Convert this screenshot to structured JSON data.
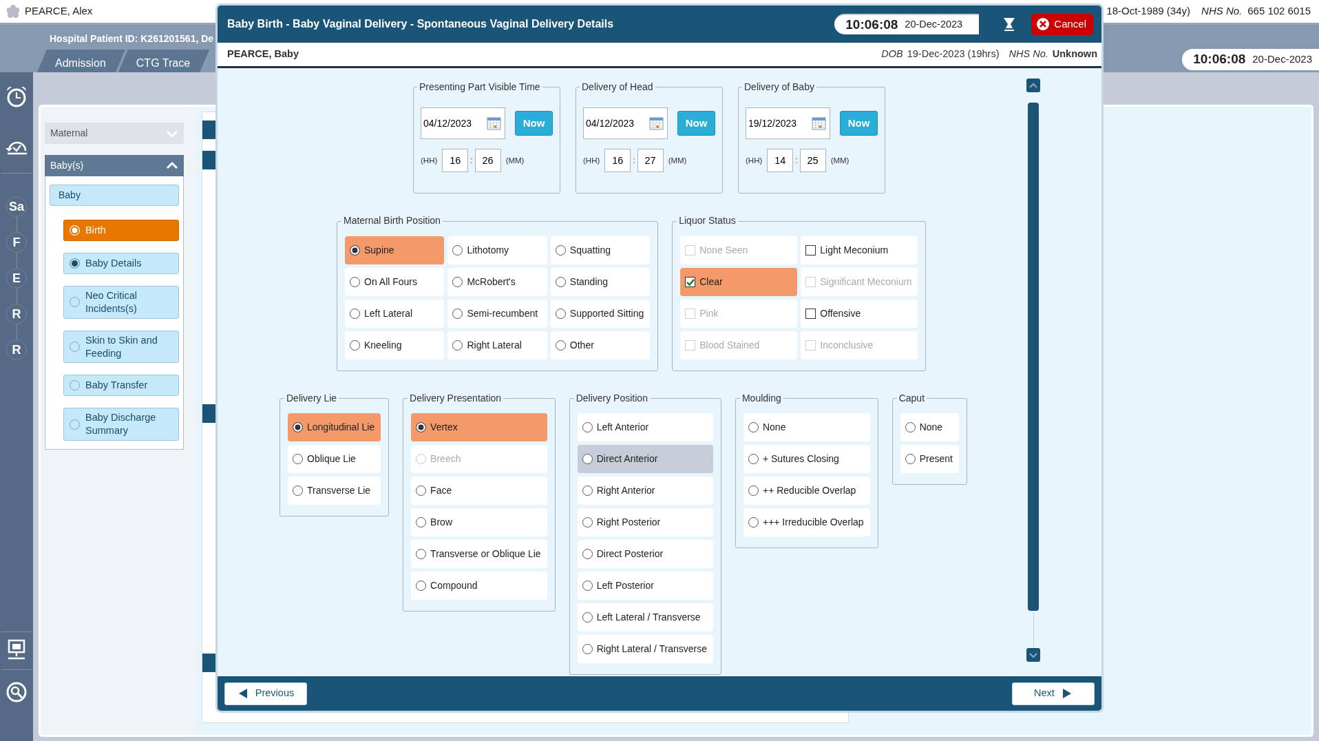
{
  "app": {
    "patient_name": "PEARCE, Alex",
    "patient_id": "Hospital Patient ID: K261201561, De",
    "dob": "18-Oct-1989 (34y)",
    "nhs_label": "NHS No.",
    "nhs_number": "665 102 6015",
    "time": "10:06:08",
    "date": "20-Dec-2023",
    "tabs": [
      {
        "label": "Admission",
        "selected": false
      },
      {
        "label": "CTG Trace",
        "selected": false
      }
    ],
    "steps": [
      "Sa",
      "F",
      "E",
      "R",
      "R"
    ]
  },
  "sidebar": {
    "groups": [
      {
        "label": "Maternal",
        "expanded": false
      },
      {
        "label": "Baby(s)",
        "expanded": true
      }
    ],
    "parent": "Baby",
    "items": [
      {
        "label": "Birth",
        "selected": true,
        "complete": false
      },
      {
        "label": "Baby Details",
        "selected": false,
        "complete": true
      },
      {
        "label": "Neo Critical Incidents(s)",
        "selected": false,
        "complete": false
      },
      {
        "label": "Skin to Skin and Feeding",
        "selected": false,
        "complete": false
      },
      {
        "label": "Baby Transfer",
        "selected": false,
        "complete": false
      },
      {
        "label": "Baby Discharge Summary",
        "selected": false,
        "complete": false
      }
    ]
  },
  "modal": {
    "title": "Baby Birth - Baby Vaginal Delivery - Spontaneous Vaginal Delivery Details",
    "time": "10:06:08",
    "date": "20-Dec-2023",
    "cancel": "Cancel",
    "patient": "PEARCE, Baby",
    "dob_label": "DOB",
    "dob": "19-Dec-2023 (19hrs)",
    "nhs_label": "NHS No.",
    "nhs": "Unknown",
    "previous": "Previous",
    "next": "Next",
    "rows": [
      {
        "groups": [
          {
            "kind": "time",
            "legend": "Presenting Part Visible Time",
            "date": "04/12/2023",
            "now": "Now",
            "hh_label": "(HH)",
            "hh": "16",
            "separator": ":",
            "mm": "26",
            "mm_label": "(MM)"
          },
          {
            "kind": "time",
            "legend": "Delivery of Head",
            "date": "04/12/2023",
            "now": "Now",
            "hh_label": "(HH)",
            "hh": "16",
            "separator": ":",
            "mm": "27",
            "mm_label": "(MM)"
          },
          {
            "kind": "time",
            "legend": "Delivery of Baby",
            "date": "19/12/2023",
            "now": "Now",
            "hh_label": "(HH)",
            "hh": "14",
            "separator": ":",
            "mm": "25",
            "mm_label": "(MM)"
          }
        ]
      },
      {
        "groups": [
          {
            "kind": "radio",
            "legend": "Maternal Birth Position",
            "option_rows": [
              [
                {
                  "label": "Supine",
                  "selected": true
                },
                {
                  "label": "Lithotomy",
                  "selected": false
                },
                {
                  "label": "Squatting",
                  "selected": false
                }
              ],
              [
                {
                  "label": "On All Fours",
                  "selected": false
                },
                {
                  "label": "McRobert's",
                  "selected": false
                },
                {
                  "label": "Standing",
                  "selected": false
                }
              ],
              [
                {
                  "label": "Left Lateral",
                  "selected": false
                },
                {
                  "label": "Semi-recumbent",
                  "selected": false
                },
                {
                  "label": "Supported Sitting",
                  "selected": false
                }
              ],
              [
                {
                  "label": "Kneeling",
                  "selected": false
                },
                {
                  "label": "Right Lateral",
                  "selected": false
                },
                {
                  "label": "Other",
                  "selected": false
                }
              ]
            ]
          },
          {
            "kind": "checkbox",
            "legend": "Liquor Status",
            "option_rows": [
              [
                {
                  "label": "None Seen",
                  "checked": false,
                  "disabled": true
                },
                {
                  "label": "Light Meconium",
                  "checked": false,
                  "disabled": false
                }
              ],
              [
                {
                  "label": "Clear",
                  "checked": true,
                  "disabled": false
                },
                {
                  "label": "Significant Meconium",
                  "checked": false,
                  "disabled": true
                }
              ],
              [
                {
                  "label": "Pink",
                  "checked": false,
                  "disabled": true
                },
                {
                  "label": "Offensive",
                  "checked": false,
                  "disabled": false
                }
              ],
              [
                {
                  "label": "Blood Stained",
                  "checked": false,
                  "disabled": true
                },
                {
                  "label": "Inconclusive",
                  "checked": false,
                  "disabled": true
                }
              ]
            ]
          }
        ]
      },
      {
        "groups": [
          {
            "kind": "radio",
            "legend": "Delivery Lie",
            "option_rows": [
              [
                {
                  "label": "Longitudinal Lie",
                  "selected": true
                }
              ],
              [
                {
                  "label": "Oblique Lie",
                  "selected": false
                }
              ],
              [
                {
                  "label": "Transverse Lie",
                  "selected": false
                }
              ]
            ]
          },
          {
            "kind": "radio",
            "legend": "Delivery Presentation",
            "option_rows": [
              [
                {
                  "label": "Vertex",
                  "selected": true,
                  "disabled": false
                }
              ],
              [
                {
                  "label": "Breech",
                  "selected": false,
                  "disabled": true
                }
              ],
              [
                {
                  "label": "Face",
                  "selected": false,
                  "disabled": false
                }
              ],
              [
                {
                  "label": "Brow",
                  "selected": false,
                  "disabled": false
                }
              ],
              [
                {
                  "label": "Transverse or Oblique Lie",
                  "selected": false,
                  "disabled": false
                }
              ],
              [
                {
                  "label": "Compound",
                  "selected": false,
                  "disabled": false
                }
              ]
            ]
          },
          {
            "kind": "radio",
            "legend": "Delivery Position",
            "option_rows": [
              [
                {
                  "label": "Left Anterior",
                  "selected": false,
                  "highlighted": false
                }
              ],
              [
                {
                  "label": "Direct Anterior",
                  "selected": false,
                  "highlighted": true
                }
              ],
              [
                {
                  "label": "Right Anterior",
                  "selected": false,
                  "highlighted": false
                }
              ],
              [
                {
                  "label": "Right Posterior",
                  "selected": false,
                  "highlighted": false
                }
              ],
              [
                {
                  "label": "Direct Posterior",
                  "selected": false,
                  "highlighted": false
                }
              ],
              [
                {
                  "label": "Left Posterior",
                  "selected": false,
                  "highlighted": false
                }
              ],
              [
                {
                  "label": "Left Lateral / Transverse",
                  "selected": false,
                  "highlighted": false
                }
              ],
              [
                {
                  "label": "Right Lateral / Transverse",
                  "selected": false,
                  "highlighted": false
                }
              ]
            ]
          },
          {
            "kind": "radio",
            "legend": "Moulding",
            "option_rows": [
              [
                {
                  "label": "None",
                  "selected": false
                }
              ],
              [
                {
                  "label": "+ Sutures Closing",
                  "selected": false
                }
              ],
              [
                {
                  "label": "++ Reducible Overlap",
                  "selected": false
                }
              ],
              [
                {
                  "label": "+++ Irreducible Overlap",
                  "selected": false
                }
              ]
            ]
          },
          {
            "kind": "radio",
            "legend": "Caput",
            "option_rows": [
              [
                {
                  "label": "None",
                  "selected": false
                }
              ],
              [
                {
                  "label": "Present",
                  "selected": false
                }
              ]
            ]
          }
        ]
      }
    ]
  }
}
